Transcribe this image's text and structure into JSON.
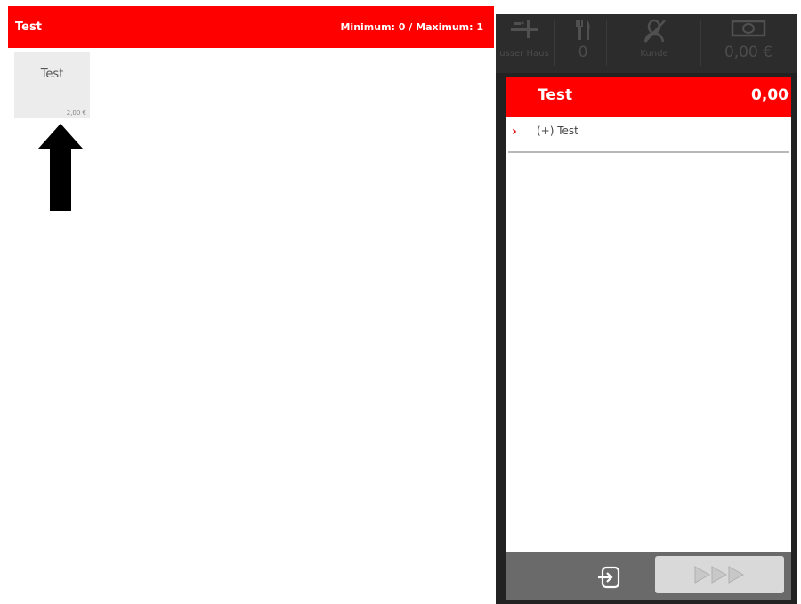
{
  "left_panel": {
    "title": "Test",
    "min_max": "Minimum: 0 / Maximum: 1",
    "product": {
      "name": "Test",
      "price": "2,00 €"
    }
  },
  "right_panel": {
    "toolbar": {
      "service_icon": "service-bell-icon",
      "service_label": "usser Haus",
      "guests_icon": "fork-knife-icon",
      "guests_value": "0",
      "customer_icon": "customer-icon",
      "customer_label": "Kunde",
      "cash_icon": "banknote-icon",
      "cash_value": "0,00 €"
    },
    "order": {
      "title": "Test",
      "total": "0,00",
      "items": [
        {
          "marker": "›",
          "text": "(+) Test"
        }
      ]
    },
    "bottom": {
      "exit_icon": "exit-icon",
      "next_icon": "triple-play-icon"
    }
  },
  "colors": {
    "accent": "#ff0000",
    "panel_dark": "#222222",
    "tile_bg": "#ececec",
    "bottom_bar": "#6a6a6a",
    "next_btn": "#d9d9d9"
  }
}
